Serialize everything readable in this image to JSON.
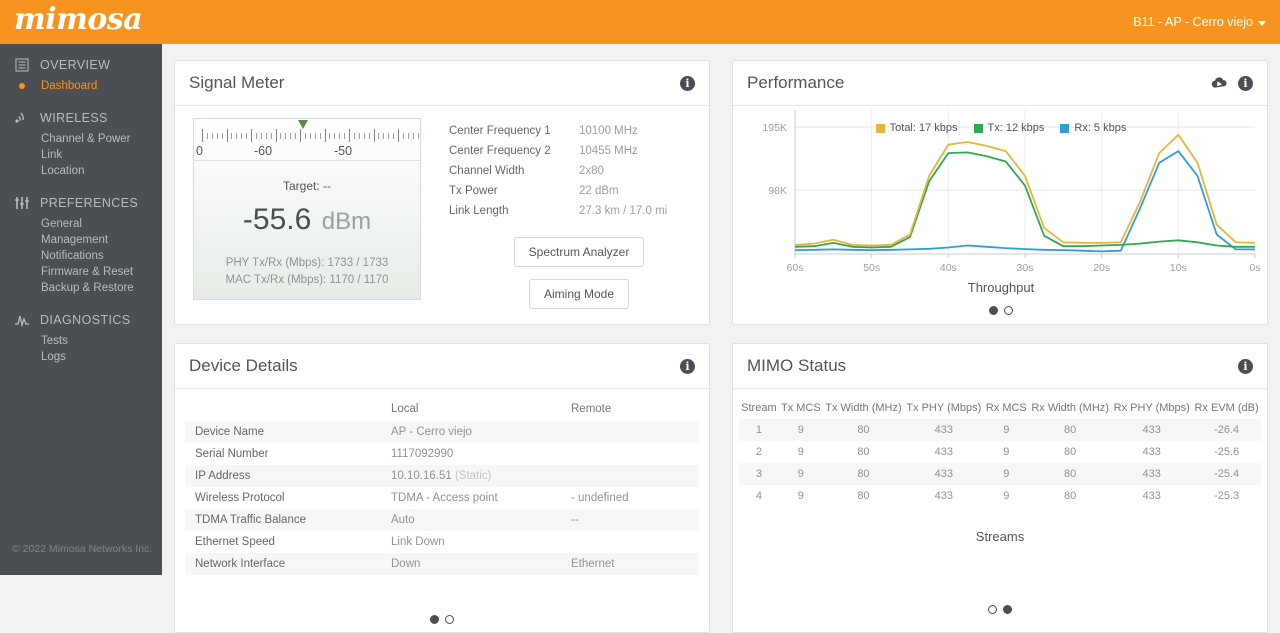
{
  "header": {
    "logo": "mimosa",
    "device_selector": "B11 - AP - Cerro viejo",
    "accent_color": "#f79420"
  },
  "sidebar": {
    "copyright": "© 2022 Mimosa Networks Inc.",
    "groups": [
      {
        "label": "OVERVIEW",
        "icon": "list-icon",
        "items": [
          {
            "label": "Dashboard",
            "active": true
          }
        ]
      },
      {
        "label": "WIRELESS",
        "icon": "signal-icon",
        "items": [
          {
            "label": "Channel & Power",
            "active": false
          },
          {
            "label": "Link",
            "active": false
          },
          {
            "label": "Location",
            "active": false
          }
        ]
      },
      {
        "label": "PREFERENCES",
        "icon": "sliders-icon",
        "items": [
          {
            "label": "General",
            "active": false
          },
          {
            "label": "Management",
            "active": false
          },
          {
            "label": "Notifications",
            "active": false
          },
          {
            "label": "Firmware & Reset",
            "active": false
          },
          {
            "label": "Backup & Restore",
            "active": false
          }
        ]
      },
      {
        "label": "DIAGNOSTICS",
        "icon": "pulse-icon",
        "items": [
          {
            "label": "Tests",
            "active": false
          },
          {
            "label": "Logs",
            "active": false
          }
        ]
      }
    ]
  },
  "signal_meter": {
    "title": "Signal Meter",
    "scale_labels": [
      "0",
      "-60",
      "-50"
    ],
    "target_label": "Target:  --",
    "value": "-55.6",
    "unit": "dBm",
    "phy_rate": "PHY Tx/Rx (Mbps):  1733  /  1733",
    "mac_rate": "MAC Tx/Rx (Mbps):  1170  /  1170",
    "details": [
      {
        "key": "Center Frequency 1",
        "value": "10100 MHz"
      },
      {
        "key": "Center Frequency 2",
        "value": "10455 MHz"
      },
      {
        "key": "Channel Width",
        "value": "2x80"
      },
      {
        "key": "Tx Power",
        "value": "22 dBm"
      },
      {
        "key": "Link Length",
        "value": "27.3 km / 17.0 mi"
      }
    ],
    "spectrum_button": "Spectrum Analyzer",
    "aiming_button": "Aiming Mode"
  },
  "performance": {
    "title": "Performance",
    "subtitle": "Throughput",
    "page_dots": [
      "on",
      "off"
    ]
  },
  "chart_data": {
    "type": "line",
    "title": "Performance",
    "subtitle": "Throughput",
    "xlabel": "",
    "ylabel": "",
    "x_ticks": [
      "60s",
      "50s",
      "40s",
      "30s",
      "20s",
      "10s",
      "0s"
    ],
    "y_ticks": [
      "98K",
      "195K"
    ],
    "ylim": [
      0,
      215000
    ],
    "grid": true,
    "legend_position": "top-center",
    "series": [
      {
        "name": "Total",
        "label": "Total: 17 kbps",
        "color": "#e8b53a",
        "values": [
          14000,
          16000,
          22000,
          14000,
          13000,
          14000,
          30000,
          120000,
          168000,
          172000,
          166000,
          158000,
          120000,
          40000,
          18000,
          17000,
          17000,
          18000,
          80000,
          155000,
          183000,
          140000,
          45000,
          18000,
          17000
        ]
      },
      {
        "name": "Tx",
        "label": "Tx: 12 kbps",
        "color": "#2fa84f",
        "values": [
          11000,
          12000,
          17000,
          11000,
          10000,
          11000,
          26000,
          112000,
          155000,
          156000,
          150000,
          142000,
          105000,
          28000,
          12000,
          12000,
          13000,
          14000,
          16000,
          19000,
          21000,
          18000,
          13000,
          11000,
          11000
        ]
      },
      {
        "name": "Rx",
        "label": "Rx: 5 kbps",
        "color": "#2f9ed8",
        "values": [
          6000,
          6500,
          7000,
          6500,
          6000,
          6500,
          7000,
          8000,
          10000,
          13000,
          11000,
          9000,
          7500,
          6500,
          6000,
          5000,
          4000,
          5000,
          70000,
          140000,
          158000,
          120000,
          30000,
          7000,
          7000
        ]
      }
    ]
  },
  "device_details": {
    "title": "Device Details",
    "columns": [
      "",
      "Local",
      "Remote"
    ],
    "rows": [
      {
        "key": "Device Name",
        "local": "AP - Cerro viejo",
        "remote": ""
      },
      {
        "key": "Serial Number",
        "local": "1117092990",
        "remote": ""
      },
      {
        "key": "IP Address",
        "local": "10.10.16.51",
        "local_suffix": "(Static)",
        "remote": ""
      },
      {
        "key": "Wireless Protocol",
        "local": "TDMA - Access point",
        "remote": "- undefined"
      },
      {
        "key": "TDMA Traffic Balance",
        "local": "Auto",
        "remote": "--"
      },
      {
        "key": "Ethernet Speed",
        "local": "Link Down",
        "remote": ""
      },
      {
        "key": "Network Interface",
        "local": "Down",
        "remote": "Ethernet"
      }
    ],
    "page_dots": [
      "on",
      "off"
    ]
  },
  "mimo_status": {
    "title": "MIMO Status",
    "subtitle": "Streams",
    "columns": [
      "Stream",
      "Tx MCS",
      "Tx Width (MHz)",
      "Tx PHY (Mbps)",
      "Rx MCS",
      "Rx Width (MHz)",
      "Rx PHY (Mbps)",
      "Rx EVM (dB)"
    ],
    "rows": [
      [
        "1",
        "9",
        "80",
        "433",
        "9",
        "80",
        "433",
        "-26.4"
      ],
      [
        "2",
        "9",
        "80",
        "433",
        "9",
        "80",
        "433",
        "-25.6"
      ],
      [
        "3",
        "9",
        "80",
        "433",
        "9",
        "80",
        "433",
        "-25.4"
      ],
      [
        "4",
        "9",
        "80",
        "433",
        "9",
        "80",
        "433",
        "-25.3"
      ]
    ],
    "page_dots": [
      "off",
      "on"
    ]
  }
}
